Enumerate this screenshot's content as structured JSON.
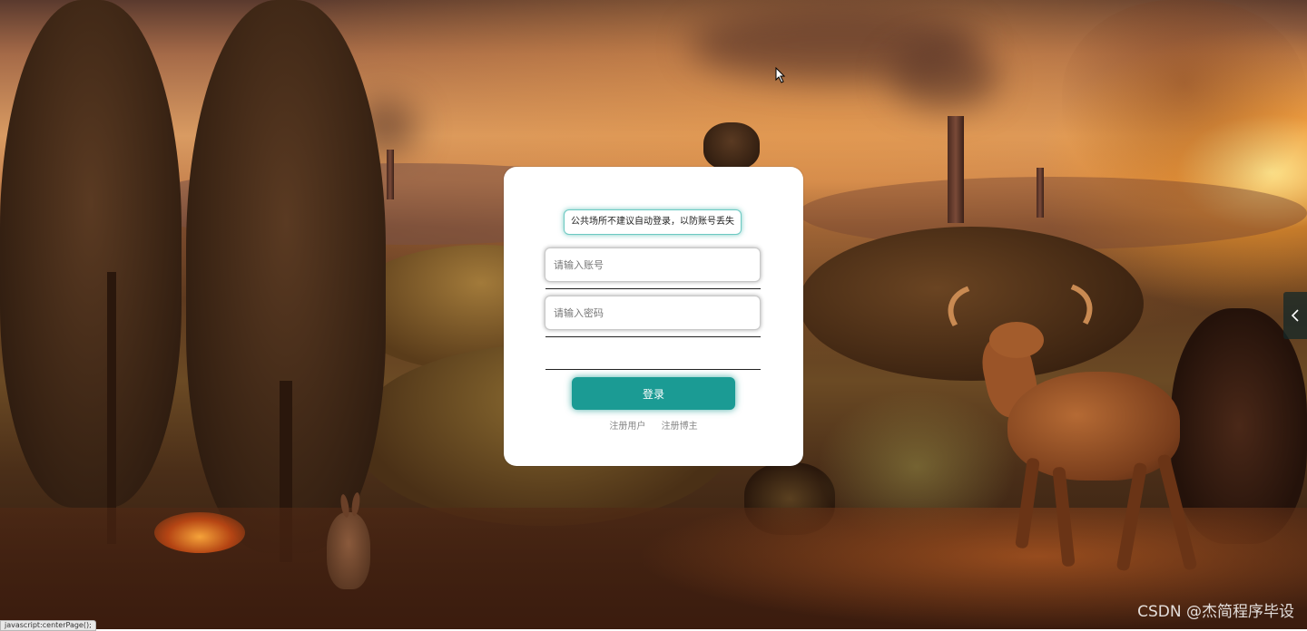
{
  "login": {
    "notice": "公共场所不建议自动登录，以防账号丢失",
    "username_placeholder": "请输入账号",
    "password_placeholder": "请输入密码",
    "login_label": "登录",
    "register_user_label": "注册用户",
    "register_blogger_label": "注册博主"
  },
  "side_tab": {
    "icon": "chevron-left-icon"
  },
  "status_bar": {
    "text": "javascript:centerPage();"
  },
  "watermark": {
    "text": "CSDN @杰简程序毕设"
  },
  "colors": {
    "accent": "#1b9b94",
    "notice_border": "#6cc9c2",
    "card_bg": "#ffffff"
  }
}
